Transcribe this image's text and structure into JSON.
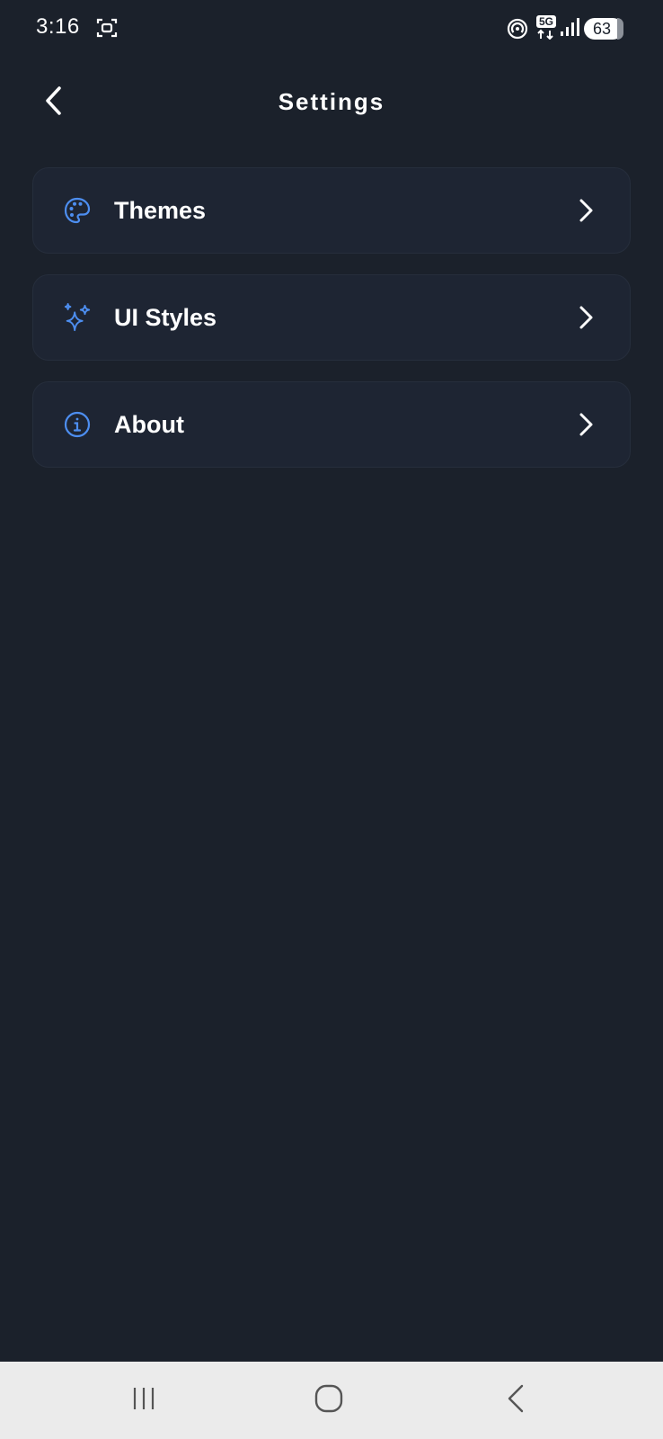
{
  "status_bar": {
    "time": "3:16",
    "network": "5G",
    "battery": "63",
    "icons": [
      "screenshot-icon",
      "hotspot-icon",
      "5g-network-icon",
      "signal-icon",
      "battery-icon"
    ]
  },
  "header": {
    "title": "Settings",
    "back_icon": "chevron-left-icon"
  },
  "settings": {
    "items": [
      {
        "label": "Themes",
        "icon": "palette-icon"
      },
      {
        "label": "UI Styles",
        "icon": "sparkles-icon"
      },
      {
        "label": "About",
        "icon": "info-icon"
      }
    ]
  },
  "nav_bar": {
    "buttons": [
      "recent-apps-icon",
      "home-icon",
      "back-icon"
    ]
  },
  "colors": {
    "background": "#1b212b",
    "card": "#1e2533",
    "accent": "#4d8ef0",
    "text": "#ffffff",
    "nav_background": "#ebebeb"
  }
}
